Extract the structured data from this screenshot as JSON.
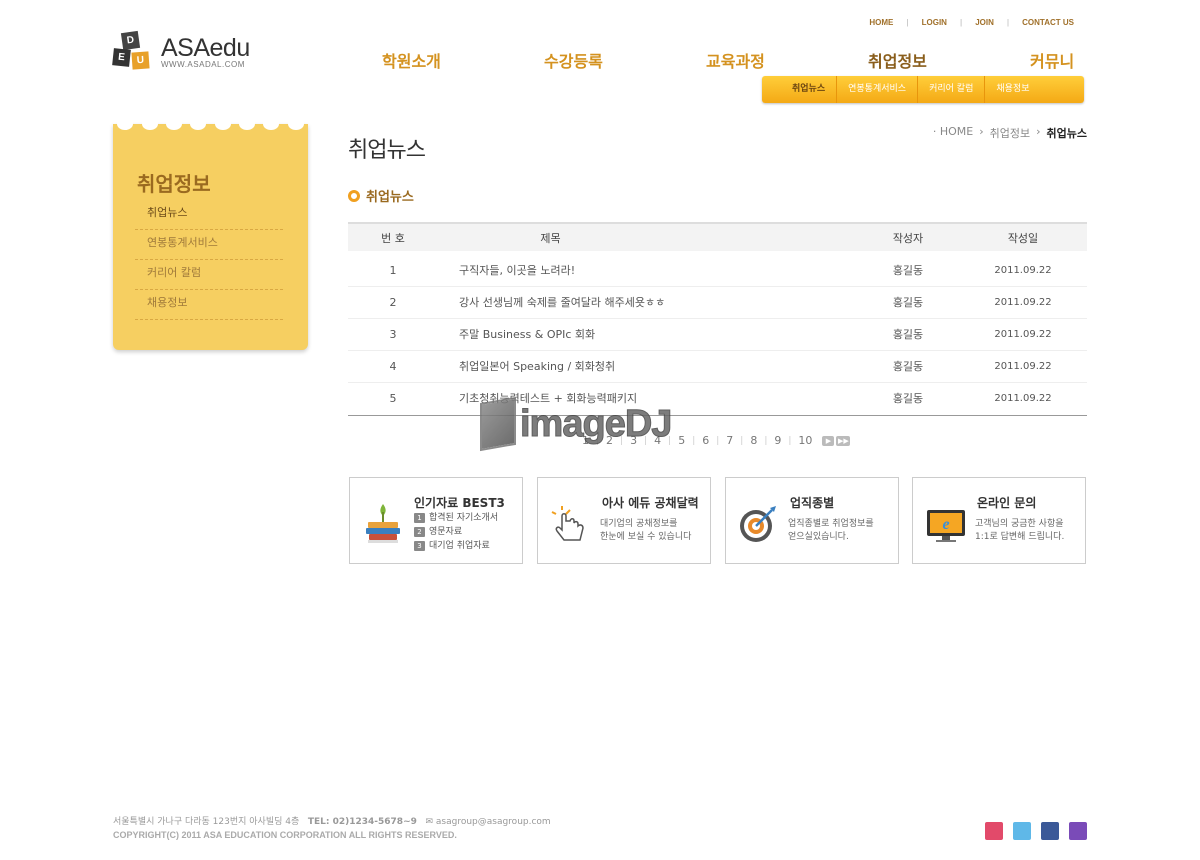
{
  "util_nav": [
    "HOME",
    "LOGIN",
    "JOIN",
    "CONTACT US"
  ],
  "logo": {
    "blocks": [
      "D",
      "E",
      "U"
    ],
    "name": "ASAedu",
    "url": "WWW.ASADAL.COM"
  },
  "gnb": [
    "학원소개",
    "수강등록",
    "교육과정",
    "취업정보",
    "커뮤니티"
  ],
  "subnav": [
    "취업뉴스",
    "연봉통계서비스",
    "커리어 칼럼",
    "채용정보"
  ],
  "lnb": {
    "title": "취업정보",
    "items": [
      "취업뉴스",
      "연봉통계서비스",
      "커리어 칼럼",
      "채용정보"
    ]
  },
  "content": {
    "title": "취업뉴스",
    "breadcrumb": [
      "· HOME",
      "취업정보",
      "취업뉴스"
    ],
    "section_title": "취업뉴스"
  },
  "board": {
    "headers": [
      "번 호",
      "제목",
      "작성자",
      "작성일"
    ],
    "rows": [
      {
        "no": "1",
        "title": "구직자들, 이곳을 노려라!",
        "writer": "홍길동",
        "date": "2011.09.22"
      },
      {
        "no": "2",
        "title": "강사 선생님께 숙제를 줄여달라 해주세욧ㅎㅎ",
        "writer": "홍길동",
        "date": "2011.09.22"
      },
      {
        "no": "3",
        "title": "주말 Business & OPIc 회화",
        "writer": "홍길동",
        "date": "2011.09.22"
      },
      {
        "no": "4",
        "title": "취업일본어 Speaking / 회화청취",
        "writer": "홍길동",
        "date": "2011.09.22"
      },
      {
        "no": "5",
        "title": "기초청취능력테스트 + 회화능력패키지",
        "writer": "홍길동",
        "date": "2011.09.22"
      }
    ]
  },
  "paging": {
    "pages": [
      "1",
      "2",
      "3",
      "4",
      "5",
      "6",
      "7",
      "8",
      "9",
      "10"
    ],
    "current": "1"
  },
  "watermark": "imageDJ",
  "banners": [
    {
      "title": "인기자료 BEST3",
      "list": [
        {
          "n": "1",
          "text": "합격된 자기소개서"
        },
        {
          "n": "2",
          "text": "영문자료"
        },
        {
          "n": "3",
          "text": "대기업 취업자료"
        }
      ],
      "icon": "books-icon"
    },
    {
      "title": "아사 에듀 공채달력",
      "lines": [
        "대기업의 공채정보를",
        "한눈에 보실 수 있습니다"
      ],
      "icon": "pointer-hand-icon"
    },
    {
      "title": "업직종별",
      "lines": [
        "업직종별로 취업정보를",
        "얻으실있습니다."
      ],
      "icon": "target-icon"
    },
    {
      "title": "온라인 문의",
      "lines": [
        "고객님의 궁금한 사항을",
        "1:1로 답변해 드립니다."
      ],
      "icon": "monitor-icon"
    }
  ],
  "footer": {
    "address": "서울특별시 가나구 다라동 123번지 아사빌딩 4층",
    "tel": "TEL: 02)1234-5678~9",
    "email": "asagroup@asagroup.com",
    "copyright": "COPYRIGHT(C) 2011 ASA EDUCATION CORPORATION ALL RIGHTS RESERVED."
  },
  "sns": [
    "cyworld-icon",
    "twitter-icon",
    "facebook-icon",
    "me2day-icon"
  ],
  "colors": {
    "accent": "#d4921f",
    "brown": "#9a6a20",
    "sidebar": "#f6cf61",
    "subbar": "#f4a915"
  }
}
